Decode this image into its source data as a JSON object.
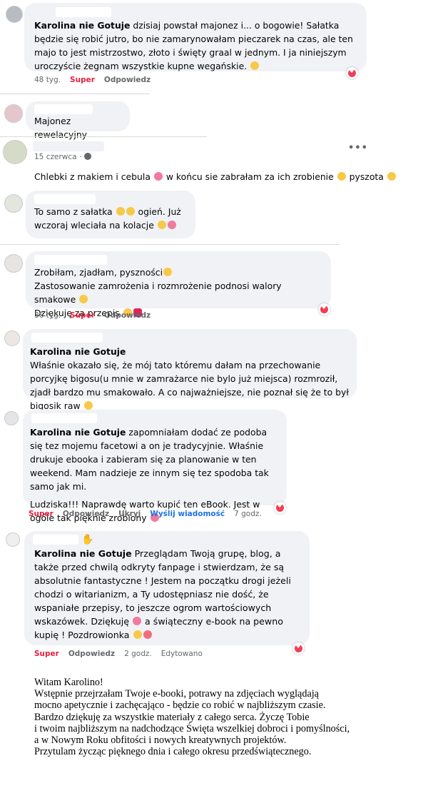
{
  "comments": [
    {
      "author": "Karolina nie Gotuje",
      "text": " dzisiaj powstał majonez i... o bogowie! Sałatka będzie się robić jutro, bo nie zamarynowałam pieczarek na czas, ale ten majo to jest mistrzostwo, złoto i święty graal w jednym. I ja niniejszym uroczyście żegnam wszystkie kupne wegańskie.",
      "time": "48 tyg.",
      "like": "Super",
      "reply": "Odpowiedz"
    },
    {
      "text": "Majonez rewelacyjny"
    },
    {
      "date": "15 czerwca",
      "text_a": "Chlebki z makiem i cebula",
      "text_b": "w końcu sie zabrałam za ich zrobienie",
      "text_c": "pyszota"
    },
    {
      "text_a": "To samo z sałatka",
      "text_b": "ogień. Już",
      "text_c": "wczoraj wleciała na kolacje"
    },
    {
      "line1": "Zrobiłam, zjadłam, pyszności",
      "line2": "Zastosowanie zamrożenia i rozmrożenie podnosi walory smakowe",
      "line3": "Dziękuję za przepis",
      "time": "36 tyg.",
      "like": "Super",
      "reply": "Odpowiedz"
    },
    {
      "author": "Karolina nie Gotuje",
      "text": "Właśnie okazało się, że mój tato któremu dałam na przechowanie porcyjkę bigosu(u mnie w zamrażarce nie bylo już miejsca) rozmroził, zjadł bardzo mu smakowało. A co najważniejsze, nie poznał się że to był bigosik raw"
    },
    {
      "author": "Karolina nie Gotuje",
      "text": " zapomniałam dodać ze podoba się tez mojemu facetowi a on je tradycyjnie. Właśnie drukuje ebooka i zabieram się za planowanie w ten weekend. Mam nadzieje ze innym się tez spodoba tak samo jak mi.",
      "text2": "Ludziska!!! Naprawdę warto kupić ten eBook. Jest w ogóle tak pięknie zrobiony",
      "like": "Super",
      "reply": "Odpowiedz",
      "hide": "Ukryj",
      "message": "Wyślij wiadomość",
      "time": "7 godz."
    },
    {
      "author": "Karolina nie Gotuje",
      "text_a": " Przeglądam Twoją grupę, blog, a także przed chwilą odkryty fanpage i stwierdzam, że są absolutnie fantastyczne ! Jestem na początku drogi jeżeli chodzi o witarianizm, a Ty udostępniasz nie dość, że wspaniałe przepisy, to jeszcze ogrom wartościowych wskazówek. Dziękuję",
      "text_b": " a świąteczny e-book na pewno kupię ! Pozdrowionka",
      "like": "Super",
      "reply": "Odpowiedz",
      "time": "2 godz.",
      "edited": "Edytowano"
    }
  ],
  "letter": [
    "Witam Karolino!",
    "Wstępnie przejrzałam Twoje e-booki, potrawy na zdjęciach wyglądają",
    "mocno apetycznie i zachęcająco - będzie co robić w najbliższym czasie.",
    "Bardzo dziękuję za wszystkie materiały z całego serca. Życzę Tobie",
    "i twoim najbliższym na nadchodzące Święta wszelkiej dobroci i pomyślności,",
    "a w Nowym Roku obfitości i nowych kreatywnych projektów.",
    "Przytulam życząc pięknego dnia i całego okresu przedświątecznego."
  ],
  "colors": {
    "bubble": "#f0f2f5",
    "super": "#e41e3f",
    "meta": "#65676b",
    "heart": "#f33e58"
  },
  "icons": [
    "heart-reaction-icon",
    "globe-icon",
    "more-options-icon",
    "waving-hand-icon",
    "emoji-icon"
  ]
}
